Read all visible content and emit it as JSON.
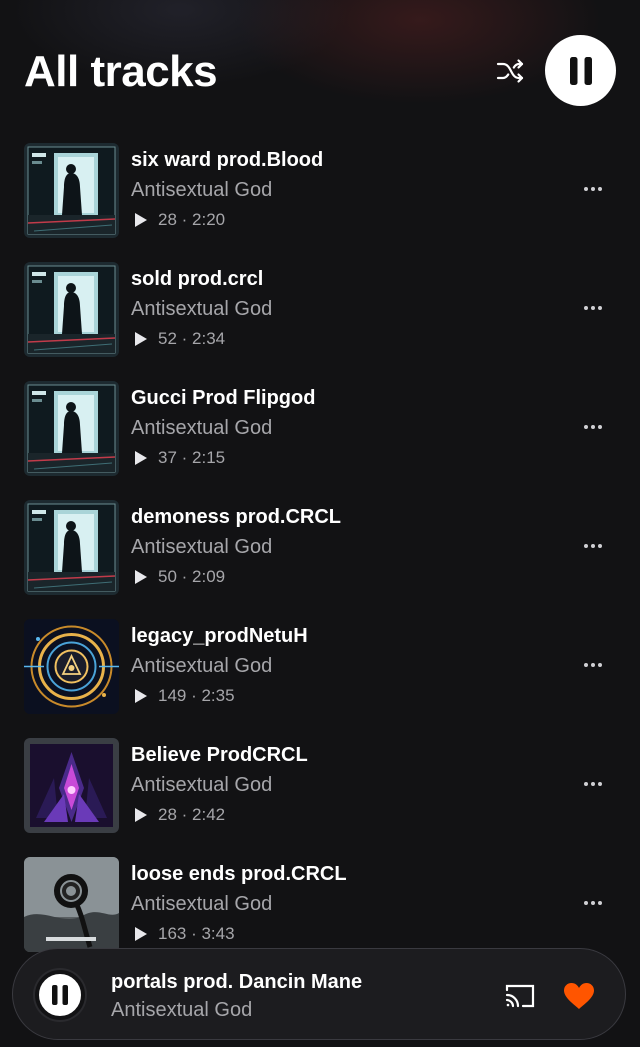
{
  "header": {
    "title": "All tracks"
  },
  "tracks": [
    {
      "title": "six ward prod.Blood",
      "artist": "Antisextual God",
      "stats": "28 · 2:20",
      "cover": "door"
    },
    {
      "title": "sold prod.crcl",
      "artist": "Antisextual God",
      "stats": "52 · 2:34",
      "cover": "door"
    },
    {
      "title": "Gucci Prod Flipgod",
      "artist": "Antisextual God",
      "stats": "37 · 2:15",
      "cover": "door"
    },
    {
      "title": "demoness prod.CRCL",
      "artist": "Antisextual God",
      "stats": "50 · 2:09",
      "cover": "door"
    },
    {
      "title": "legacy_prodNetuH",
      "artist": "Antisextual God",
      "stats": "149 · 2:35",
      "cover": "rings"
    },
    {
      "title": "Believe ProdCRCL",
      "artist": "Antisextual God",
      "stats": "28 · 2:42",
      "cover": "spikes"
    },
    {
      "title": "loose ends prod.CRCL",
      "artist": "Antisextual God",
      "stats": "163 · 3:43",
      "cover": "knot"
    }
  ],
  "player": {
    "title": "portals prod. Dancin Mane",
    "artist": "Antisextual God",
    "liked": true,
    "accent": "#ff5500"
  },
  "icons": {
    "shuffle": "shuffle-icon",
    "pause": "pause-icon",
    "play": "play-icon",
    "more": "more-options-icon",
    "cast": "cast-icon",
    "heart": "heart-icon"
  }
}
